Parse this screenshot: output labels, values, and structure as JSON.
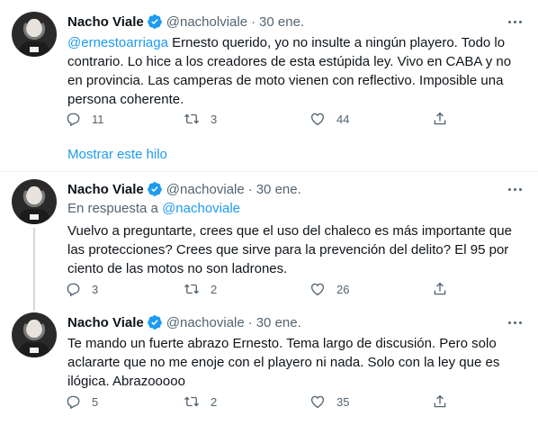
{
  "colors": {
    "accent": "#1d9bf0",
    "secondary_text": "#536471",
    "primary_text": "#0f1419"
  },
  "show_thread_label": "Mostrar este hilo",
  "tweets": [
    {
      "author": "Nacho Viale",
      "handle": "@nacholviale",
      "separator": "·",
      "date": "30 ene.",
      "reply_to_prefix": "",
      "reply_to_handle": "",
      "mention": "@ernestoarriaga",
      "text": " Ernesto querido, yo no insulte a ningún playero. Todo lo contrario. Lo hice a los creadores de esta estúpida ley. Vivo en CABA y no en provincia. Las camperas de moto vienen con reflectivo. Imposible una persona coherente.",
      "replies": "11",
      "retweets": "3",
      "likes": "44"
    },
    {
      "author": "Nacho Viale",
      "handle": "@nachoviale",
      "separator": "·",
      "date": "30 ene.",
      "reply_to_prefix": "En respuesta a ",
      "reply_to_handle": "@nachoviale",
      "mention": "",
      "text": "Vuelvo a preguntarte, crees que el uso del chaleco es más importante que las protecciones? Crees que sirve para la prevención del delito? El 95 por ciento de las motos no son ladrones.",
      "replies": "3",
      "retweets": "2",
      "likes": "26"
    },
    {
      "author": "Nacho Viale",
      "handle": "@nachoviale",
      "separator": "·",
      "date": "30 ene.",
      "reply_to_prefix": "",
      "reply_to_handle": "",
      "mention": "",
      "text": "Te mando un fuerte abrazo Ernesto. Tema largo de discusión. Pero solo aclararte que no me enoje con el playero ni nada. Solo con la ley que es ilógica. Abrazooooo",
      "replies": "5",
      "retweets": "2",
      "likes": "35"
    }
  ]
}
